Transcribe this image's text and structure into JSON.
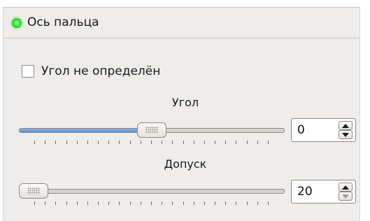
{
  "panel": {
    "title": "Ось пальца",
    "status_color": "#3ce63a"
  },
  "checkbox": {
    "label": "Угол не определён",
    "checked": false
  },
  "angle": {
    "label": "Угол",
    "value": "0",
    "slider_fraction": 0.5
  },
  "tolerance": {
    "label": "Допуск",
    "value": "20",
    "slider_fraction": 0.0
  },
  "icons": {
    "status": "green-led-icon",
    "spin_up": "arrow-up-icon",
    "spin_down": "arrow-down-icon"
  }
}
